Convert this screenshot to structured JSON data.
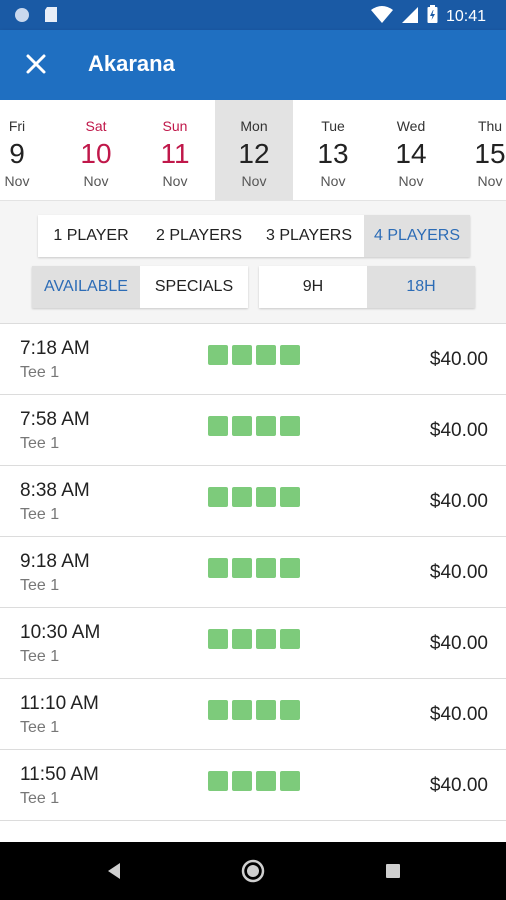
{
  "status_bar": {
    "time": "10:41"
  },
  "app_bar": {
    "title": "Akarana",
    "close_icon": "close-icon"
  },
  "colors": {
    "primary": "#1f6fc1",
    "status": "#1a5aa5",
    "weekend": "#c0184a",
    "active_text": "#2c6cb6",
    "slot_available": "#7dcb7b"
  },
  "dates": [
    {
      "dow": "Fri",
      "day": "9",
      "month": "Nov"
    },
    {
      "dow": "Sat",
      "day": "10",
      "month": "Nov"
    },
    {
      "dow": "Sun",
      "day": "11",
      "month": "Nov"
    },
    {
      "dow": "Mon",
      "day": "12",
      "month": "Nov"
    },
    {
      "dow": "Tue",
      "day": "13",
      "month": "Nov"
    },
    {
      "dow": "Wed",
      "day": "14",
      "month": "Nov"
    },
    {
      "dow": "Thu",
      "day": "15",
      "month": "Nov"
    }
  ],
  "selected_date": "Mon 12 Nov",
  "players": {
    "options": [
      "1 PLAYER",
      "2 PLAYERS",
      "3 PLAYERS",
      "4 PLAYERS"
    ],
    "selected": "4 PLAYERS"
  },
  "availability": {
    "options": [
      "AVAILABLE",
      "SPECIALS"
    ],
    "selected": "AVAILABLE"
  },
  "holes": {
    "options": [
      "9H",
      "18H"
    ],
    "selected": "18H"
  },
  "tee_times": [
    {
      "time": "7:18 AM",
      "tee": "Tee 1",
      "price": "$40.00",
      "slots": 4
    },
    {
      "time": "7:58 AM",
      "tee": "Tee 1",
      "price": "$40.00",
      "slots": 4
    },
    {
      "time": "8:38 AM",
      "tee": "Tee 1",
      "price": "$40.00",
      "slots": 4
    },
    {
      "time": "9:18 AM",
      "tee": "Tee 1",
      "price": "$40.00",
      "slots": 4
    },
    {
      "time": "10:30 AM",
      "tee": "Tee 1",
      "price": "$40.00",
      "slots": 4
    },
    {
      "time": "11:10 AM",
      "tee": "Tee 1",
      "price": "$40.00",
      "slots": 4
    },
    {
      "time": "11:50 AM",
      "tee": "Tee 1",
      "price": "$40.00",
      "slots": 4
    }
  ],
  "nav_bar": {
    "icons": [
      "back-icon",
      "home-icon",
      "recents-icon"
    ]
  }
}
